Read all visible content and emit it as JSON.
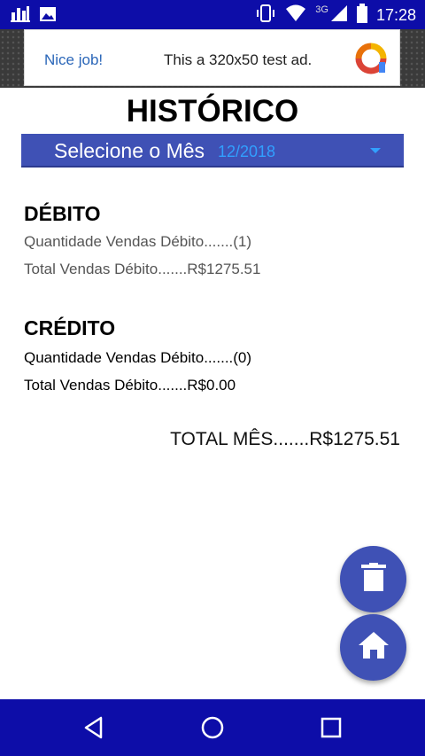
{
  "status_bar": {
    "time": "17:28",
    "network": "3G",
    "icons": [
      "chart-icon",
      "image-icon",
      "vibrate-icon",
      "wifi-icon",
      "signal-icon",
      "battery-icon"
    ]
  },
  "ad": {
    "title": "Nice job!",
    "text": "This a 320x50 test ad."
  },
  "page": {
    "title": "HISTÓRICO"
  },
  "month_selector": {
    "label": "Selecione o Mês",
    "value": "12/2018"
  },
  "debito": {
    "heading": "DÉBITO",
    "quantidade": "Quantidade Vendas Débito.......(1)",
    "total": "Total Vendas Débito.......R$1275.51"
  },
  "credito": {
    "heading": "CRÉDITO",
    "quantidade": "Quantidade Vendas Débito.......(0)",
    "total": "Total Vendas Débito.......R$0.00"
  },
  "total_mes": "TOTAL MÊS.......R$1275.51",
  "fabs": {
    "delete_icon": "trash-icon",
    "home_icon": "home-icon"
  },
  "nav": [
    "back-icon",
    "home-circle-icon",
    "recents-icon"
  ],
  "colors": {
    "status_bar": "#0d0da8",
    "accent": "#3f51b5",
    "month_value": "#31a0ff",
    "ad_title": "#2a66b8"
  }
}
